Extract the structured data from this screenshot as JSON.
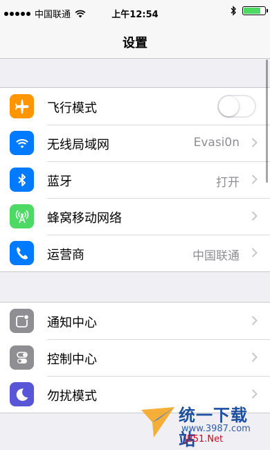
{
  "status_bar": {
    "carrier": "中国联通",
    "time": "上午12:54",
    "signal_icon": "signal-dots-icon",
    "wifi_icon": "wifi-icon",
    "bluetooth_icon": "bluetooth-icon",
    "battery_level": 0.9,
    "battery_color": "#4cd964"
  },
  "nav": {
    "title": "设置"
  },
  "groups": [
    {
      "rows": [
        {
          "label": "飞行模式",
          "icon": "airplane-icon",
          "icon_bg": "#ff9500",
          "toggle": false
        },
        {
          "label": "无线局域网",
          "icon": "wifi-icon",
          "icon_bg": "#007aff",
          "value": "Evasi0n"
        },
        {
          "label": "蓝牙",
          "icon": "bluetooth-icon",
          "icon_bg": "#007aff",
          "value": "打开"
        },
        {
          "label": "蜂窝移动网络",
          "icon": "cellular-antenna-icon",
          "icon_bg": "#4cd964"
        },
        {
          "label": "运营商",
          "icon": "phone-icon",
          "icon_bg": "#007aff",
          "value": "中国联通"
        }
      ]
    },
    {
      "rows": [
        {
          "label": "通知中心",
          "icon": "notification-center-icon",
          "icon_bg": "#8e8e93"
        },
        {
          "label": "控制中心",
          "icon": "control-center-icon",
          "icon_bg": "#8e8e93"
        },
        {
          "label": "勿扰模式",
          "icon": "moon-icon",
          "icon_bg": "#5856d6"
        }
      ]
    }
  ],
  "watermark": {
    "title": "统一下载站",
    "url": "www.3987.com",
    "site": "JB51.Net"
  }
}
